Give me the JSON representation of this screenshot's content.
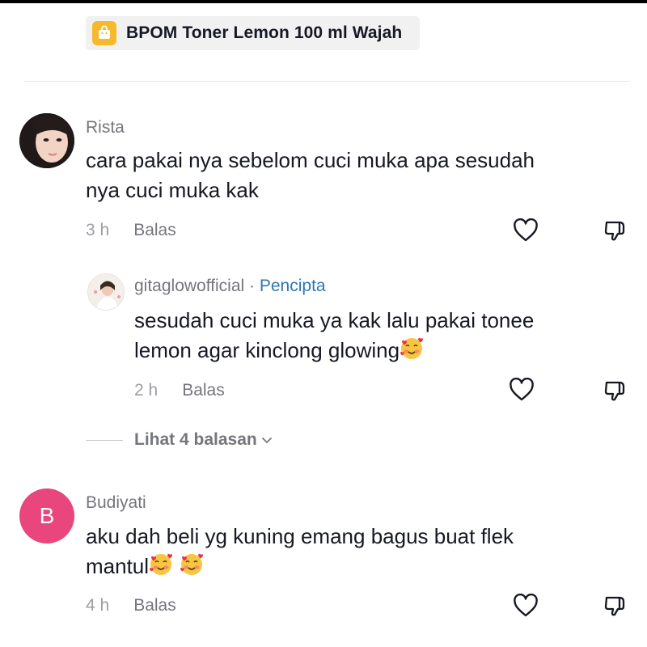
{
  "product": {
    "icon": "shopping-bag-icon",
    "name": "BPOM Toner Lemon 100 ml Wajah",
    "accent_color": "#f7b92c"
  },
  "comments": [
    {
      "username": "Rista",
      "avatar": "photo-avatar",
      "lines": [
        "cara pakai nya sebelom cuci muka apa sesudah",
        "nya cuci muka kak"
      ],
      "time": "3 h",
      "reply_label": "Balas",
      "replies": [
        {
          "username": "gitaglowofficial",
          "separator": " · ",
          "badge": "Pencipta",
          "avatar": "photo-avatar",
          "lines": [
            "sesudah cuci muka ya kak lalu pakai tonee",
            "lemon agar kinclong glowing"
          ],
          "time": "2 h",
          "reply_label": "Balas"
        }
      ],
      "view_replies": "Lihat 4 balasan"
    },
    {
      "username": "Budiyati",
      "avatar_letter": "B",
      "avatar_color": "#e8467c",
      "lines": [
        "aku dah beli yg kuning emang bagus buat flek",
        "mantul"
      ],
      "time": "4 h",
      "reply_label": "Balas"
    }
  ],
  "colors": {
    "text": "#161823",
    "muted": "#75767c",
    "creator": "#2f77b1"
  }
}
